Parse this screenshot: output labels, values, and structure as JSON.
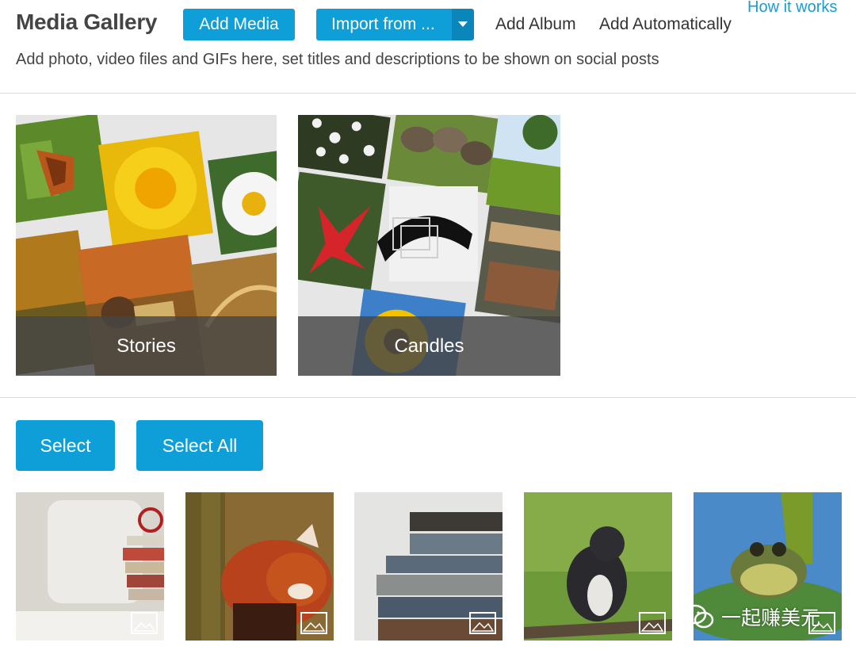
{
  "header": {
    "title": "Media Gallery",
    "add_media_label": "Add Media",
    "import_label": "Import from ...",
    "add_album_label": "Add Album",
    "add_auto_label": "Add Automatically",
    "how_label": "How it works",
    "subtitle": "Add photo, video files and GIFs here, set titles and descriptions to be shown on social posts"
  },
  "albums": [
    {
      "name": "Stories"
    },
    {
      "name": "Candles"
    }
  ],
  "selection": {
    "select_label": "Select",
    "select_all_label": "Select All"
  },
  "thumbnails": [
    {
      "subject": "books-pillow",
      "icon": "image-icon"
    },
    {
      "subject": "red-panda",
      "icon": "image-icon"
    },
    {
      "subject": "book-stack",
      "icon": "image-icon"
    },
    {
      "subject": "squirrel",
      "icon": "image-icon"
    },
    {
      "subject": "frog",
      "icon": "image-icon"
    }
  ],
  "watermark": {
    "text": "一起赚美元",
    "icon": "wechat-icon"
  },
  "colors": {
    "accent": "#0f9fd8",
    "accent_dark": "#0a86ba",
    "link": "#1a9cd0",
    "caption_bg": "#464646"
  }
}
